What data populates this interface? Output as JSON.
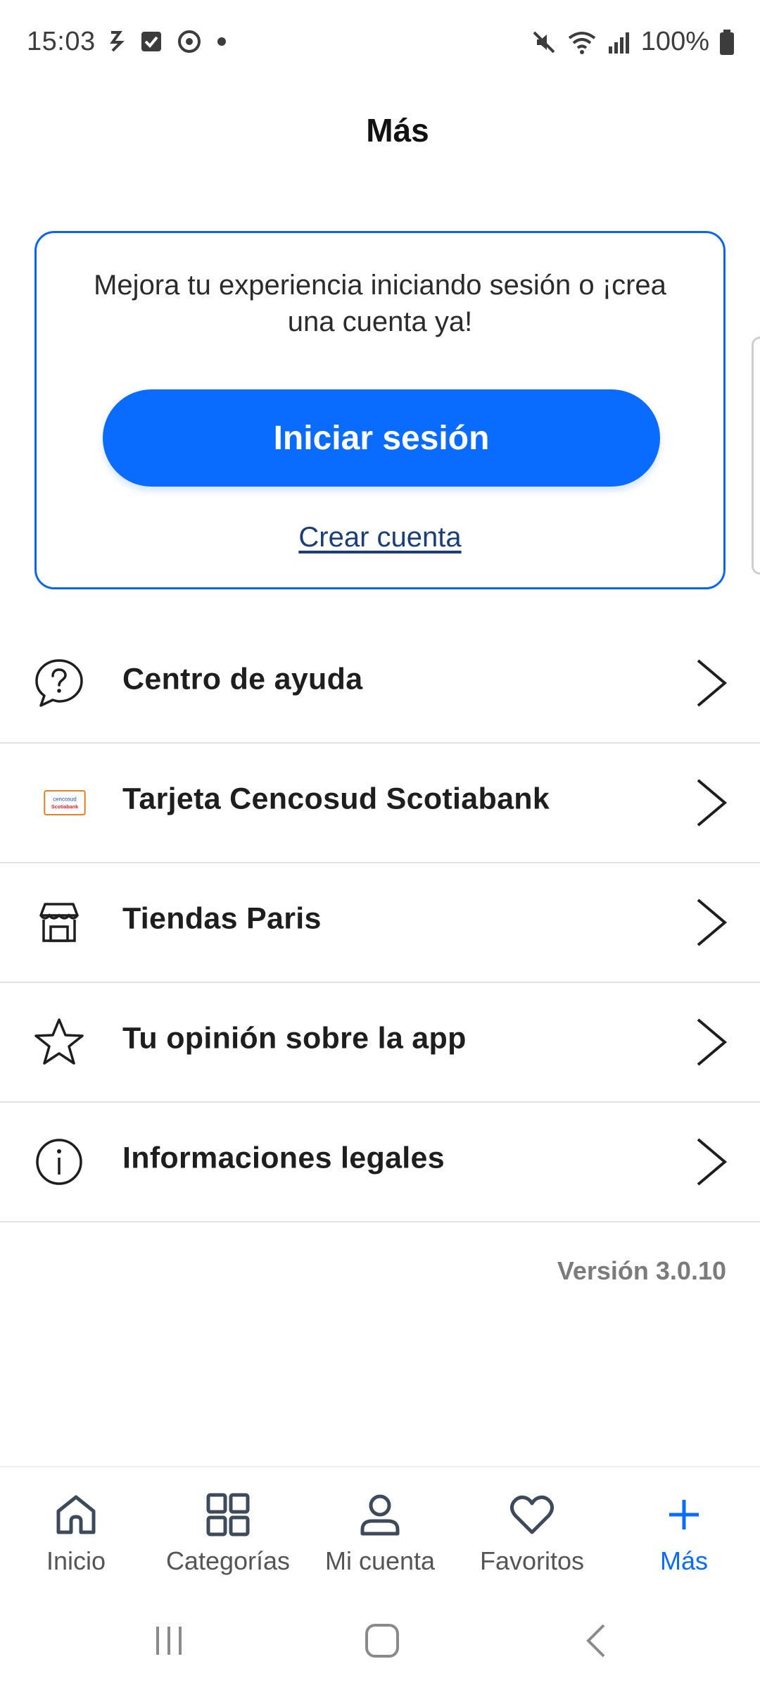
{
  "status_bar": {
    "time": "15:03",
    "battery": "100%"
  },
  "page": {
    "title": "Más"
  },
  "login_card": {
    "message": "Mejora tu experiencia iniciando sesión o ¡crea una cuenta ya!",
    "login_button": "Iniciar sesión",
    "create_account_link": "Crear cuenta"
  },
  "menu": {
    "items": [
      {
        "label": "Centro de ayuda",
        "icon": "help-chat-icon"
      },
      {
        "label": "Tarjeta Cencosud Scotiabank",
        "icon": "cencosud-scotiabank-card-icon"
      },
      {
        "label": "Tiendas Paris",
        "icon": "store-icon"
      },
      {
        "label": "Tu opinión sobre la app",
        "icon": "star-icon"
      },
      {
        "label": "Informaciones legales",
        "icon": "info-icon"
      }
    ],
    "card_logo_top": "cencosud",
    "card_logo_bottom": "Scotiabank"
  },
  "version": "Versión 3.0.10",
  "bottom_nav": {
    "items": [
      {
        "label": "Inicio",
        "icon": "home-icon"
      },
      {
        "label": "Categorías",
        "icon": "grid-icon"
      },
      {
        "label": "Mi cuenta",
        "icon": "user-icon"
      },
      {
        "label": "Favoritos",
        "icon": "heart-icon"
      },
      {
        "label": "Más",
        "icon": "plus-icon"
      }
    ],
    "active_index": 4
  },
  "colors": {
    "accent": "#0a6cff",
    "card_border": "#0a66f0",
    "link": "#1a3f78",
    "version_text": "#7b7b7b"
  }
}
